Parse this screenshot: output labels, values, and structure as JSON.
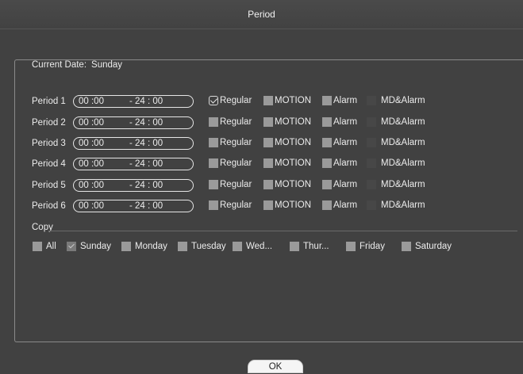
{
  "window": {
    "title": "Period"
  },
  "current_date": {
    "label": "Current Date:",
    "value": "Sunday"
  },
  "periods": [
    {
      "label": "Period 1",
      "start": "00 :00",
      "end": "- 24 : 00",
      "regular": true
    },
    {
      "label": "Period 2",
      "start": "00 :00",
      "end": "- 24 : 00",
      "regular": false
    },
    {
      "label": "Period 3",
      "start": "00 :00",
      "end": "- 24 : 00",
      "regular": false
    },
    {
      "label": "Period 4",
      "start": "00 :00",
      "end": "- 24 : 00",
      "regular": false
    },
    {
      "label": "Period 5",
      "start": "00 :00",
      "end": "- 24 : 00",
      "regular": false
    },
    {
      "label": "Period 6",
      "start": "00 :00",
      "end": "- 24 : 00",
      "regular": false
    }
  ],
  "options": {
    "regular": "Regular",
    "motion": "MOTION",
    "alarm": "Alarm",
    "md_alarm": "MD&Alarm"
  },
  "copy": {
    "label": "Copy",
    "days": [
      "All",
      "Sunday",
      "Monday",
      "Tuesday",
      "Wed...",
      "Thur...",
      "Friday",
      "Saturday"
    ],
    "checked": "Sunday"
  },
  "ok_label": "OK"
}
